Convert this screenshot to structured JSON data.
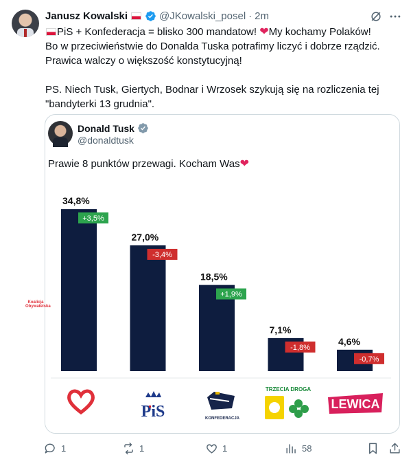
{
  "post": {
    "author_name": "Janusz Kowalski",
    "handle": "@JKowalski_posel",
    "separator": "·",
    "time": "2m",
    "line1_a": "PiS + Konfederacja = blisko 300 mandatow!",
    "line1_b": "My kochamy Polaków!",
    "line2": "Bo w przeciwieństwie do Donalda Tuska potrafimy liczyć i dobrze rządzić.",
    "line3": "Prawica walczy o większość konstytucyjną!",
    "line4": "PS. Niech Tusk, Giertych, Bodnar i Wrzosek szykują się na rozliczenia tej",
    "line5": "\"bandyterki 13 grudnia\"."
  },
  "quote": {
    "author_name": "Donald Tusk",
    "handle": "@donaldtusk",
    "text": "Prawie 8 punktów przewagi. Kocham Was"
  },
  "logos": {
    "ko_text": "Koalicja Obywatelska",
    "pis_text": "PiS",
    "konf_text": "KONFEDERACJA",
    "td_text": "TRZECIA DROGA",
    "lewica_text": "LEWICA"
  },
  "actions": {
    "replies": "1",
    "reposts": "1",
    "likes": "1",
    "views": "58"
  },
  "colors": {
    "bar": "#0e1d3f",
    "positive": "#2da44e",
    "negative": "#cf2e2e",
    "like": "#e0245e",
    "verified": "#1d9bf0"
  },
  "icons": [
    "verified-icon",
    "grok-icon",
    "more-icon",
    "reply-icon",
    "repost-icon",
    "like-icon",
    "views-icon",
    "bookmark-icon",
    "share-icon"
  ],
  "chart_data": {
    "type": "bar",
    "categories": [
      "KO",
      "PiS",
      "Konfederacja",
      "Trzecia Droga",
      "Lewica"
    ],
    "values": [
      34.8,
      27.0,
      18.5,
      7.1,
      4.6
    ],
    "value_labels": [
      "34,8%",
      "27,0%",
      "18,5%",
      "7,1%",
      "4,6%"
    ],
    "change_labels": [
      "+3,5%",
      "-3,4%",
      "+1,9%",
      "-1,8%",
      "-0,7%"
    ],
    "changes": [
      3.5,
      -3.4,
      1.9,
      -1.8,
      -0.7
    ],
    "ylim": [
      0,
      36
    ]
  }
}
